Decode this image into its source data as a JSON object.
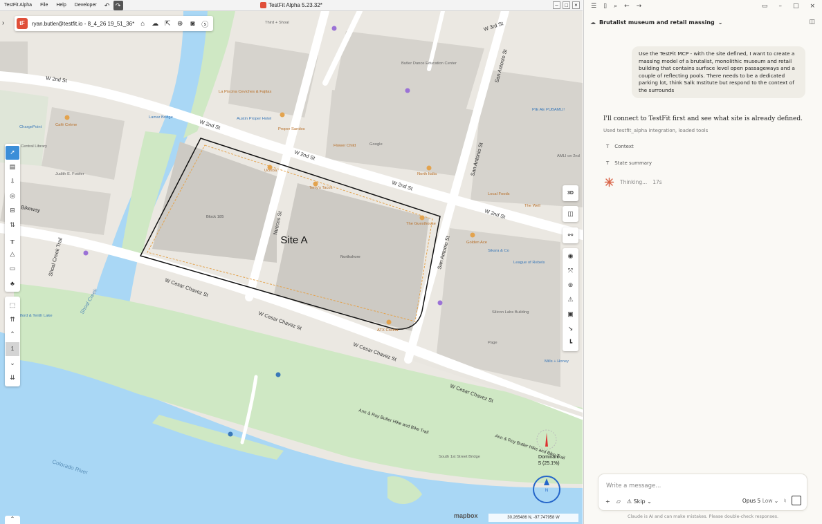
{
  "window": {
    "app_menu": [
      "TestFit Alpha",
      "File",
      "Help",
      "Developer"
    ],
    "title": "TestFit Alpha 5.23.32*",
    "undo_icon": "undo-icon",
    "redo_icon": "redo-icon"
  },
  "topbar": {
    "logo_text": "tF",
    "account_text": "ryan.butler@testfit.io - 8_4_26 19_51_36*",
    "icons": [
      "home-icon",
      "cloud-icon",
      "share-icon",
      "add-icon",
      "camera-icon",
      "help-icon"
    ]
  },
  "left_tools": [
    "select-icon",
    "building-icon",
    "parking-structure-icon",
    "context-icon",
    "car-icon",
    "measure-icon",
    "table-icon",
    "terrain-icon",
    "ruler-icon",
    "tree-icon"
  ],
  "floor": {
    "level": "1"
  },
  "right_tools": {
    "view_mode": "3D"
  },
  "map": {
    "site_label": "Site A",
    "streets": [
      "W 2nd St",
      "W 2nd St",
      "W 2nd St",
      "W 2nd St",
      "W 2nd St",
      "W 3rd St",
      "W Cesar Chavez St",
      "W Cesar Chavez St",
      "W Cesar Chavez St",
      "W Cesar Chavez St",
      "Nueces St",
      "San Antonio St",
      "San Antonio St",
      "San Antonio St",
      "Shoal Creek Trail",
      "Shoal Creek",
      "Ann & Roy Butler Hike and Bike Trail",
      "Ann & Roy Butler Hike and Bike Trail",
      "Colorado River",
      "Bikeway"
    ],
    "pois": [
      "Third + Shoal",
      "Butler Dance Education Center",
      "La Piscina Ceviches & Fajitas",
      "Austin Proper Hotel",
      "Proper Sandos",
      "Flower Child",
      "Google",
      "PIE AE PUBAMLI!",
      "ChargePoint",
      "Café Crème",
      "Lamar Bridge",
      "Central Library",
      "Judith E. Fowler",
      "Uchiba",
      "Terry's Tacos",
      "North Italia",
      "AMLI on 2nd",
      "Local Foods",
      "The Well",
      "Block 185",
      "The Guesthouse",
      "Northshore",
      "Golden Ace",
      "Sikara & Co",
      "League of Rebels",
      "Silicon Labs Building",
      "ATX Cocina",
      "Page",
      "Mills + Honey",
      "South 1st Street Bridge",
      "Stratford & Tenth Lake"
    ],
    "compass_label": "N",
    "dominant_label": "Dominant",
    "dominant_value": "S (25.1%)",
    "mapbox_label": "mapbox",
    "coordinates": "30.265486 N, -97.747958 W"
  },
  "chat": {
    "conversation_title": "Brutalist museum and retail massing",
    "user_message": "Use the TestFit MCP - with the site defined, I want to create a massing model of a brutalist, monolithic museum and retail building that contains surface level open passageways and a couple of reflecting pools. There needs to be a dedicated parking lot, think Salk Institute but respond to the context of the surrounds",
    "assistant_message": "I'll connect to TestFit first and see what site is already defined.",
    "used_tools_text": "Used testfit_alpha integration, loaded tools",
    "tool_calls": [
      "Context",
      "State summary"
    ],
    "thinking_label": "Thinking...",
    "thinking_time": "17s",
    "input_placeholder": "Write a message...",
    "skip_label": "Skip",
    "model_name": "Opus 5",
    "effort": "Low",
    "disclaimer": "Claude is AI and can make mistakes. Please double-check responses."
  },
  "colors": {
    "water": "#a9d7f5",
    "park": "#cfe8c4",
    "block": "#d6d3cd",
    "road": "#ffffff",
    "accent": "#3b8ed8",
    "brand": "#e04f39"
  }
}
